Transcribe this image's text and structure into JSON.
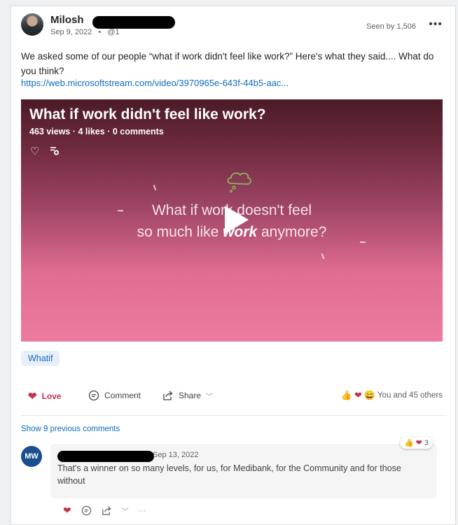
{
  "post": {
    "author": "Milosh",
    "date": "Sep 9, 2022",
    "separator": "•",
    "mention": "@1",
    "seen_by": "Seen by 1,506",
    "text": "We asked some of our people “what if work didn't feel like work?” Here's what they said.... What do you think?",
    "link": "https://web.microsoftstream.com/video/3970965e-643f-44b5-aac..."
  },
  "video": {
    "title": "What if work didn't feel like work?",
    "stats": "463 views · 4 likes · 0 comments",
    "tagline_line1": "What if work doesn't feel",
    "tagline_line2_prefix": "so much like ",
    "tagline_word": "work",
    "tagline_line2_suffix": " anymore?"
  },
  "hashtag": "Whatif",
  "actions": {
    "love": "Love",
    "comment": "Comment",
    "share": "Share"
  },
  "reactions_summary": "You and 45 others",
  "show_previous": "Show 9 previous comments",
  "comment": {
    "avatar_initials": "MW",
    "date": "Sep 13, 2022",
    "text": "That's a winner on so many levels, for us, for Medibank, for the Community and for those without",
    "reaction_count": "3"
  },
  "icons": {
    "more": "more-icon",
    "heart": "heart-icon",
    "comment": "comment-icon",
    "share": "share-icon",
    "play": "play-icon"
  },
  "colors": {
    "accent": "#0f6cbd",
    "love": "#c4314b",
    "video_top": "#4b1b26",
    "video_bottom": "#ed7b9f"
  }
}
